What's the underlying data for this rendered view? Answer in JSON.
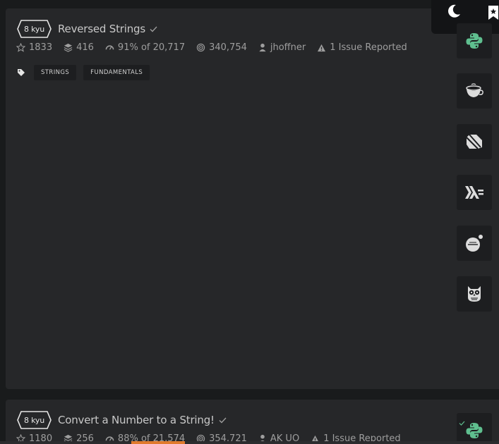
{
  "header": {
    "theme_toggle_icon": "moon-icon",
    "bookmark_icon": "bookmark-star-icon"
  },
  "kata": [
    {
      "rank": "8 kyu",
      "title": "Reversed Strings",
      "stars": "1833",
      "collections": "416",
      "satisfaction": "91% of 20,717",
      "completed": "340,754",
      "author": "jhoffner",
      "issues": "1 Issue Reported",
      "tags": [
        "STRINGS",
        "FUNDAMENTALS"
      ],
      "languages": [
        "python-icon",
        "coffeescript-icon",
        "dart-icon",
        "haskell-icon",
        "pharo-icon",
        "owl-icon"
      ]
    },
    {
      "rank": "8 kyu",
      "title": "Convert a Number to a String!",
      "stars": "1180",
      "collections": "256",
      "satisfaction": "88% of 21,574",
      "completed": "354,721",
      "author": "AK UO",
      "issues": "1 Issue Reported",
      "languages": [
        "python-icon"
      ]
    }
  ],
  "colors": {
    "background": "#191b1c",
    "card": "#262729",
    "accent_green": "#5fbf8f",
    "accent_orange": "#e07a2c"
  }
}
